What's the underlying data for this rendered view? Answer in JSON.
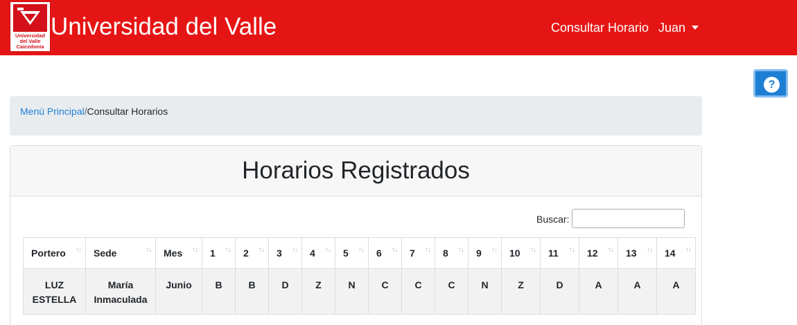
{
  "navbar": {
    "logo": {
      "line1": "Universidad",
      "line2": "del Valle",
      "line3": "Caicedonia"
    },
    "brand": "Universidad del Valle",
    "links": {
      "horario": "Consultar Horario",
      "user": "Juan"
    }
  },
  "help_button": {
    "label": "?"
  },
  "breadcrumb": {
    "home": "Menú Principal",
    "separator": "/",
    "current": "Consultar Horarios"
  },
  "card": {
    "title": "Horarios Registrados"
  },
  "search": {
    "label": "Buscar:",
    "value": "",
    "placeholder": ""
  },
  "table": {
    "sort_icon": "↑↓",
    "headers": [
      "Portero",
      "Sede",
      "Mes",
      "1",
      "2",
      "3",
      "4",
      "5",
      "6",
      "7",
      "8",
      "9",
      "10",
      "11",
      "12",
      "13",
      "14"
    ],
    "rows": [
      {
        "portero": "LUZ ESTELLA",
        "sede": "María Inmaculada",
        "mes": "Junio",
        "days": [
          "B",
          "B",
          "D",
          "Z",
          "N",
          "C",
          "C",
          "C",
          "N",
          "Z",
          "D",
          "A",
          "A",
          "A"
        ]
      }
    ]
  },
  "colors": {
    "navbar": "#e61515",
    "link": "#1e7fd6",
    "help_button": "#1d7fd4",
    "breadcrumb_bg": "#e9ecef"
  },
  "icons": {
    "logo": "univalle-logo-icon",
    "caret": "caret-down-icon",
    "help": "question-circle-icon",
    "sort": "sort-arrows-icon"
  }
}
